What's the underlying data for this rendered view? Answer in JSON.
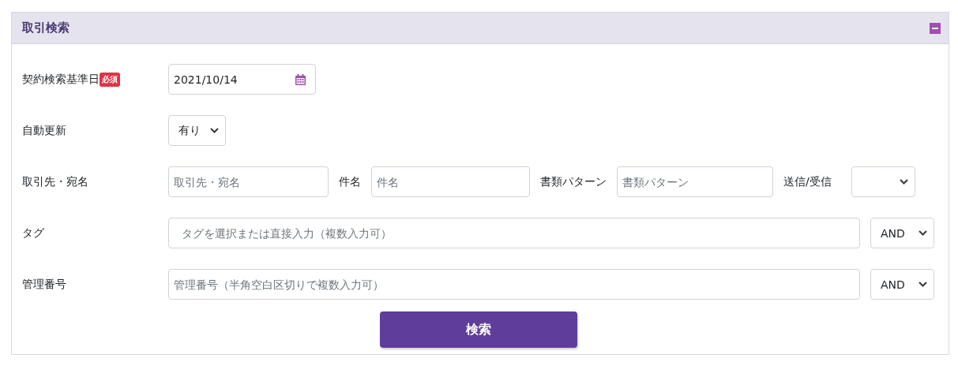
{
  "panel": {
    "title": "取引検索",
    "expanded": true
  },
  "rows": [
    {
      "kind": "date",
      "label": "契約検索基準日",
      "badge": "必須",
      "value": "2021/10/14"
    },
    {
      "kind": "select",
      "label": "自動更新",
      "value": "有り"
    },
    {
      "kind": "inline",
      "label": "取引先・宛名",
      "items": [
        {
          "kind": "field",
          "placeholder": "取引先・宛名"
        },
        {
          "kind": "label",
          "text": "件名"
        },
        {
          "kind": "field",
          "placeholder": "件名"
        },
        {
          "kind": "label",
          "text": "書類パターン"
        },
        {
          "kind": "field",
          "placeholder": "書類パターン"
        },
        {
          "kind": "label",
          "text": "送信/受信"
        },
        {
          "kind": "select"
        }
      ]
    },
    {
      "kind": "tags",
      "label": "タグ",
      "placeholder": "タグを選択または直接入力（複数入力可）",
      "operator": "AND"
    },
    {
      "kind": "wide",
      "label": "管理番号",
      "placeholder": "管理番号（半角空白区切りで複数入力可）",
      "operator": "AND"
    }
  ],
  "submit": "検索"
}
